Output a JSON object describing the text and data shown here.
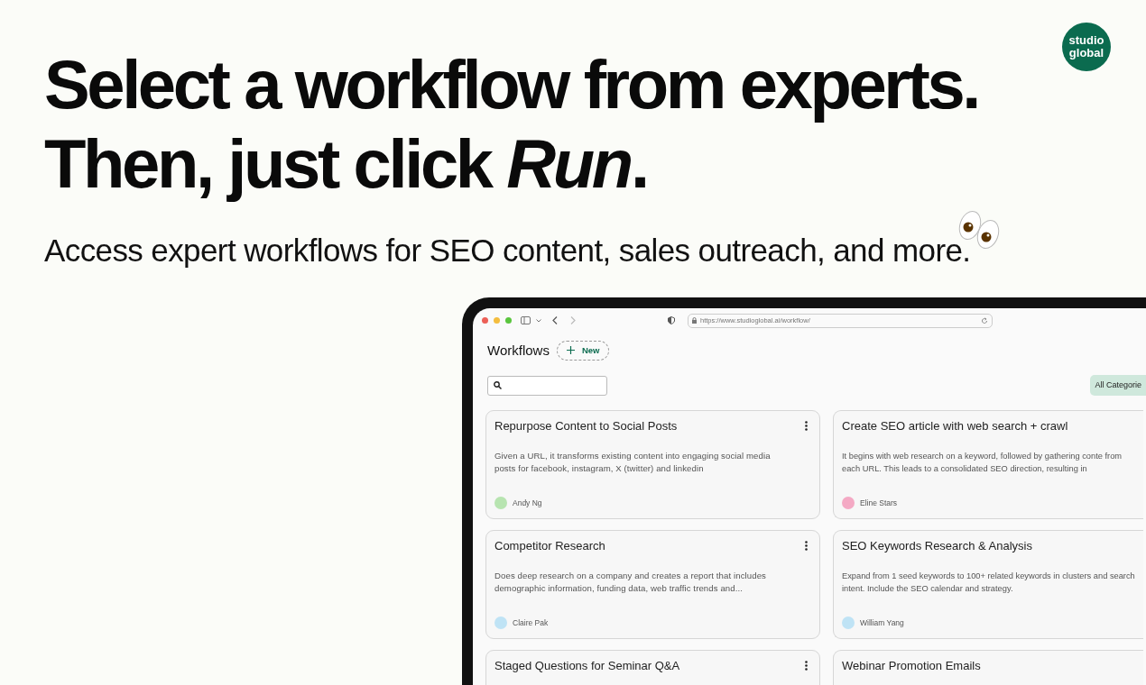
{
  "logo": {
    "line1": "studio",
    "line2": "global"
  },
  "headline": [
    "Select a workflow from experts.",
    "Then, just click *Run*."
  ],
  "subtitle": "Access expert workflows for SEO content, sales outreach, and more.",
  "browser": {
    "url": "https://www.studioglobal.ai/workflow/"
  },
  "app": {
    "title": "Workflows",
    "new_button": "New",
    "filter": {
      "label": "All Categorie",
      "selected": true
    }
  },
  "cards": [
    {
      "title": "Repurpose Content to Social Posts",
      "description": "Given a URL, it transforms existing content into engaging social media posts for facebook, instagram, X (twitter) and linkedin",
      "author": "Andy Ng",
      "color": "#b7e4b0",
      "menu": true
    },
    {
      "title": "Create SEO article with web search + crawl",
      "description": "It begins with web research on a keyword, followed by gathering conte from each URL. This leads to a consolidated SEO direction, resulting in",
      "author": "Eline Stars",
      "color": "#f4a9c4",
      "menu": false
    },
    {
      "title": "Competitor Research",
      "description": "Does deep research on a company and creates a report that includes demographic information, funding data, web traffic trends and...",
      "author": "Claire Pak",
      "color": "#bfe3f5",
      "menu": true
    },
    {
      "title": "SEO Keywords Research & Analysis",
      "description": "Expand from 1 seed keywords to 100+ related keywords in clusters and search intent. Include the SEO calendar and strategy.",
      "author": "William Yang",
      "color": "#bfe3f5",
      "menu": false
    },
    {
      "title": "Staged Questions for Seminar Q&A",
      "menu": true
    },
    {
      "title": "Webinar Promotion Emails",
      "menu": false
    }
  ]
}
